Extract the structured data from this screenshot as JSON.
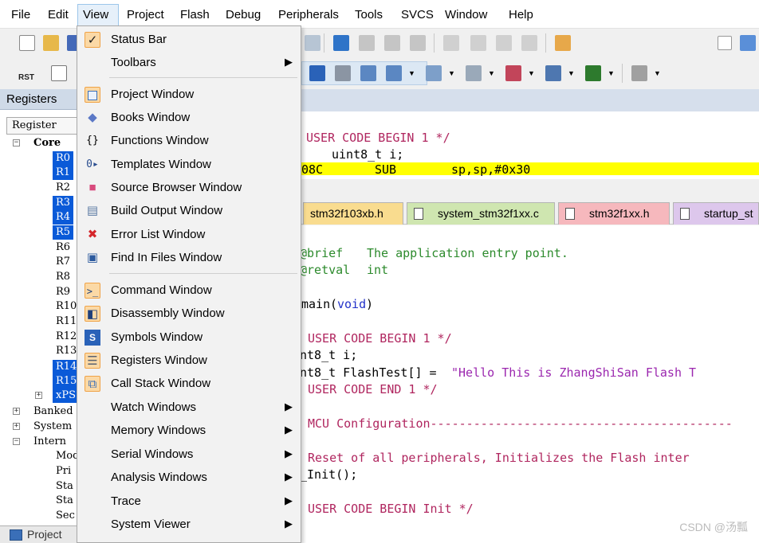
{
  "menubar": {
    "items": [
      "File",
      "Edit",
      "View",
      "Project",
      "Flash",
      "Debug",
      "Peripherals",
      "Tools",
      "SVCS",
      "Window",
      "Help"
    ],
    "active": "View"
  },
  "registers": {
    "title": "Registers",
    "column_header": "Register",
    "core_label": "Core",
    "regs": [
      "R0",
      "R1",
      "R2",
      "R3",
      "R4",
      "R5",
      "R6",
      "R7",
      "R8",
      "R9",
      "R10",
      "R11",
      "R12",
      "R13",
      "R14",
      "R15",
      "xPS"
    ],
    "selected": [
      "R0",
      "R1",
      "R3",
      "R4",
      "R5",
      "R14",
      "R15",
      "xPS"
    ],
    "groups": [
      "Banked",
      "System",
      "Intern"
    ],
    "internal_children": [
      "Mod",
      "Pri",
      "Sta",
      "Sta",
      "Sec"
    ],
    "bottom_tab": "Project"
  },
  "view_menu": {
    "items": [
      {
        "label": "Status Bar",
        "icon": "check-icon",
        "checked": true
      },
      {
        "label": "Toolbars",
        "icon": "",
        "submenu": true
      },
      {
        "label": "Project Window",
        "icon": "project-window-icon",
        "framed": true
      },
      {
        "label": "Books Window",
        "icon": "books-icon"
      },
      {
        "label": "Functions Window",
        "icon": "braces-icon"
      },
      {
        "label": "Templates Window",
        "icon": "templates-icon"
      },
      {
        "label": "Source Browser Window",
        "icon": "source-browser-icon"
      },
      {
        "label": "Build Output Window",
        "icon": "build-output-icon"
      },
      {
        "label": "Error List Window",
        "icon": "error-x-icon"
      },
      {
        "label": "Find In Files Window",
        "icon": "find-in-files-icon"
      },
      {
        "label": "Command Window",
        "icon": "command-window-icon",
        "framed": true
      },
      {
        "label": "Disassembly Window",
        "icon": "disassembly-icon",
        "framed": true
      },
      {
        "label": "Symbols Window",
        "icon": "symbols-icon"
      },
      {
        "label": "Registers Window",
        "icon": "registers-icon",
        "framed": true
      },
      {
        "label": "Call Stack Window",
        "icon": "call-stack-icon",
        "framed": true
      },
      {
        "label": "Watch Windows",
        "icon": "",
        "submenu": true
      },
      {
        "label": "Memory Windows",
        "icon": "",
        "submenu": true
      },
      {
        "label": "Serial Windows",
        "icon": "",
        "submenu": true
      },
      {
        "label": "Analysis Windows",
        "icon": "",
        "submenu": true
      },
      {
        "label": "Trace",
        "icon": "",
        "submenu": true
      },
      {
        "label": "System Viewer",
        "icon": "",
        "submenu": true
      }
    ]
  },
  "toolbar": {
    "rst_label": "RST"
  },
  "disassembly": {
    "line1_comment": "USER CODE BEGIN 1 */",
    "line2": "uint8_t i;",
    "line3_addr": "08C",
    "line3_op": "SUB",
    "line3_args": "sp,sp,#0x30"
  },
  "tabs": [
    {
      "label": "stm32f103xb.h",
      "color": "#f9dc8f"
    },
    {
      "label": "system_stm32f1xx.c",
      "color": "#cfe6b0"
    },
    {
      "label": "stm32f1xx.h",
      "color": "#f6b8bd"
    },
    {
      "label": "startup_st",
      "color": "#ddc7ec"
    }
  ],
  "code": {
    "l1_tag": "@brief",
    "l1_text": "The application entry point.",
    "l2_tag": "@retval",
    "l2_text": "int",
    "l3_fn": "main",
    "l3_open": "(",
    "l3_kw": "void",
    "l3_close": ")",
    "l4": "USER CODE BEGIN 1 */",
    "l5": "nt8_t i;",
    "l6_decl": "nt8_t FlashTest[] = ",
    "l6_str": "\"Hello This is ZhangShiSan Flash T",
    "l7": "USER CODE END 1 */",
    "l8": "MCU Configuration------------------------------------------",
    "l9": "Reset of all peripherals, Initializes the Flash inter",
    "l10": "_Init();",
    "l11": "USER CODE BEGIN Init */"
  },
  "watermark": "CSDN @汤瓢"
}
